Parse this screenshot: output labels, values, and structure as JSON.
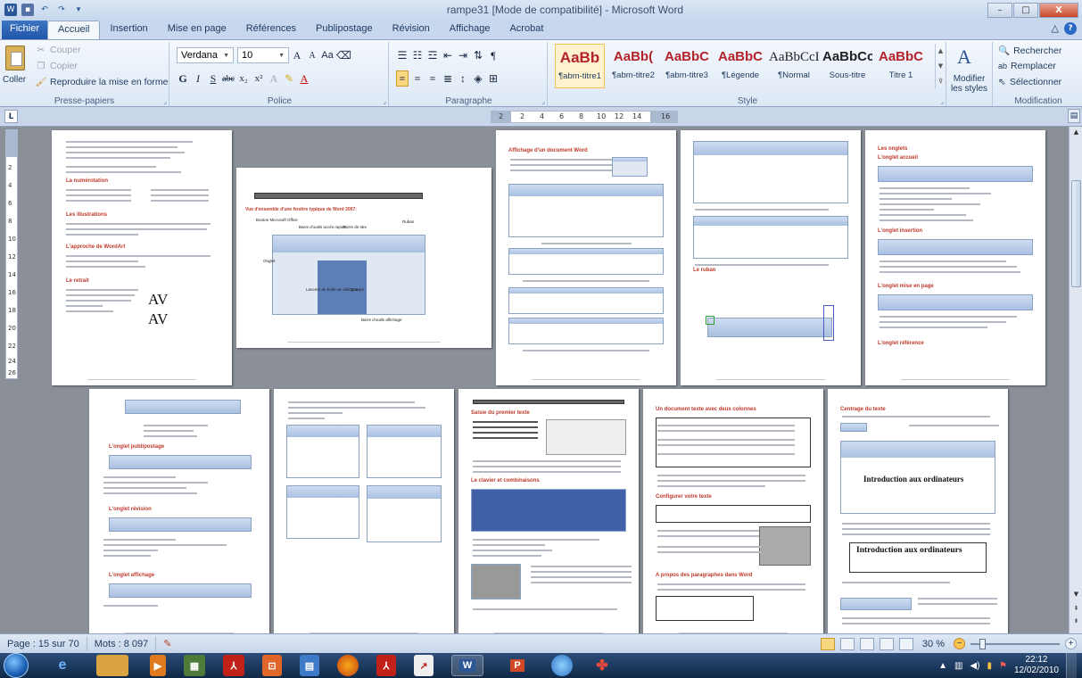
{
  "window": {
    "title": "rampe31 [Mode de compatibilité] - Microsoft Word",
    "minimize": "–",
    "maximize": "□",
    "close": "X"
  },
  "qat": [
    "word-icon",
    "save-icon",
    "undo-icon",
    "redo-icon",
    "customize-icon"
  ],
  "tabs": {
    "file": "Fichier",
    "items": [
      "Accueil",
      "Insertion",
      "Mise en page",
      "Références",
      "Publipostage",
      "Révision",
      "Affichage",
      "Acrobat"
    ],
    "active": "Accueil"
  },
  "clipboard": {
    "paste": "Coller",
    "cut": "Couper",
    "copy": "Copier",
    "format_painter": "Reproduire la mise en forme",
    "label": "Presse-papiers"
  },
  "font": {
    "name": "Verdana",
    "size": "10",
    "label": "Police",
    "grow": "A",
    "shrink": "A",
    "case": "Aa",
    "bold": "G",
    "italic": "I",
    "underline": "S",
    "strike": "abc",
    "sub": "x₂",
    "sup": "x²",
    "color_a": "A"
  },
  "paragraph": {
    "label": "Paragraphe",
    "pilcrow": "¶"
  },
  "styles": {
    "label": "Style",
    "items": [
      {
        "sample": "AaBb",
        "name": "¶abm-titre1",
        "selected": true
      },
      {
        "sample": "AaBb(",
        "name": "¶abm-titre2",
        "selected": false
      },
      {
        "sample": "AaBbC",
        "name": "¶abm-titre3",
        "selected": false
      },
      {
        "sample": "AaBbC",
        "name": "¶Légende",
        "selected": false
      },
      {
        "sample": "AaBbCcI",
        "name": "¶Normal",
        "selected": false
      },
      {
        "sample": "AaBbCc",
        "name": "Sous-titre",
        "selected": false
      },
      {
        "sample": "AaBbC",
        "name": "Titre 1",
        "selected": false
      }
    ],
    "modify": "Modifier les styles"
  },
  "editing": {
    "label": "Modification",
    "find": "Rechercher",
    "replace": "Remplacer",
    "select": "Sélectionner"
  },
  "ruler": {
    "tab_selector": "L",
    "marks": [
      "2",
      "2",
      "4",
      "6",
      "8",
      "10",
      "12",
      "14",
      "16"
    ],
    "vmarks": [
      "2",
      "4",
      "6",
      "8",
      "10",
      "12",
      "14",
      "16",
      "18",
      "20",
      "22",
      "24",
      "26"
    ]
  },
  "pages": {
    "page2_title": "Vue d'ensemble d'une fenêtre typique de Word 2007:",
    "page2_callouts": [
      "Bouton Microsoft Office",
      "Barre d'outils accès rapide",
      "Barre de titre",
      "Ruban",
      "Onglet",
      "Lanceur de boîte de dialogue",
      "Groupe",
      "Barre d'outils affichage"
    ],
    "page1_headings": [
      "La numérotation",
      "Les illustrations",
      "L'approche de WordArt",
      "Le retrait"
    ],
    "av1": "AV",
    "av2": "AV",
    "page3_heading": "Affichage d'un document Word",
    "page4_heading": "Le ruban",
    "page5_headings": [
      "Les onglets",
      "L'onglet accueil",
      "L'onglet insertion",
      "L'onglet mise en page",
      "L'onglet référence"
    ],
    "page6_headings": [
      "L'onglet publipostage",
      "L'onglet révision",
      "L'onglet affichage"
    ],
    "page8_heading": "Saisie du premier texte",
    "page8_sub": "Le clavier et combinaisons",
    "page9_heading": "Un document texte avec deux colonnes",
    "page9_sub": "Configurer votre texte",
    "page9_sub2": "A propos des paragraphes dans Word",
    "page10_heading": "Centrage du texte",
    "page10_big1": "Introduction aux ordinateurs",
    "page10_big2": "Introduction aux ordinateurs"
  },
  "statusbar": {
    "page": "Page : 15 sur 70",
    "words": "Mots : 8 097",
    "zoom": "30 %",
    "zoom_fraction": 0.3
  },
  "taskbar": {
    "apps": [
      "ie-icon",
      "explorer-icon",
      "media-player-icon",
      "calculator-icon",
      "acrobat-icon",
      "publisher-icon",
      "wordpad-icon",
      "firefox-icon",
      "acrobat-reader-icon",
      "arrow-app-icon",
      "word-icon",
      "powerpoint-icon",
      "outlook-icon",
      "paint-icon"
    ],
    "word_label": "W",
    "ppt_label": "P",
    "time": "22:12",
    "date": "12/02/2010"
  },
  "colors": {
    "accent": "#2b5797",
    "style_red": "#b4232a",
    "heading_red": "#c0392b"
  }
}
